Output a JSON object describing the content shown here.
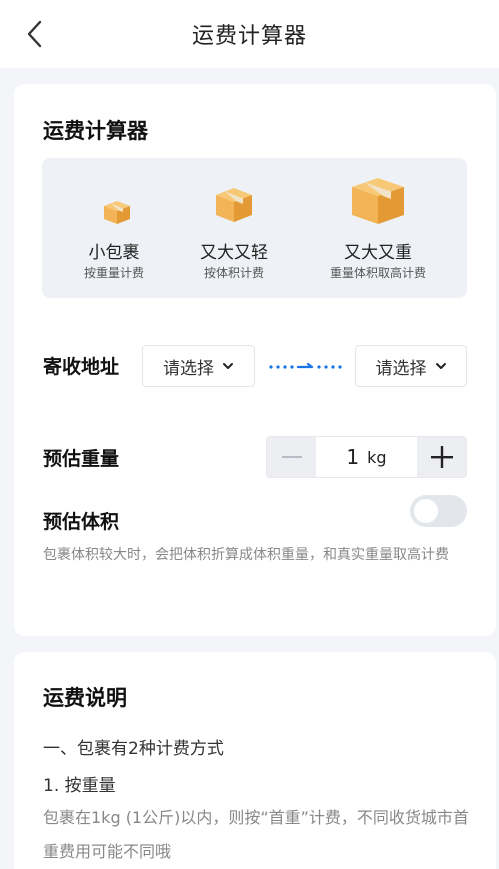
{
  "nav": {
    "title": "运费计算器"
  },
  "calculator": {
    "title": "运费计算器",
    "packages": [
      {
        "name": "小包裹",
        "desc": "按重量计费",
        "icon": "small-box-icon"
      },
      {
        "name": "又大又轻",
        "desc": "按体积计费",
        "icon": "medium-box-icon"
      },
      {
        "name": "又大又重",
        "desc": "重量体积取高计费",
        "icon": "large-box-icon"
      }
    ],
    "address": {
      "label": "寄收地址",
      "from_placeholder": "请选择",
      "to_placeholder": "请选择"
    },
    "weight": {
      "label": "预估重量",
      "value": "1",
      "unit": "kg"
    },
    "volume": {
      "label": "预估体积",
      "enabled": false,
      "hint": "包裹体积较大时，会把体积折算成体积重量，和真实重量取高计费"
    }
  },
  "explain": {
    "title": "运费说明",
    "line1": "一、包裹有2种计费方式",
    "line2": "1. 按重量",
    "body": "包裹在1kg (1公斤)以内，则按“首重”计费，不同收货城市首重费用可能不同哦"
  },
  "colors": {
    "accent": "#1a73e8",
    "box": "#f2b456",
    "box_dark": "#e39a34"
  }
}
